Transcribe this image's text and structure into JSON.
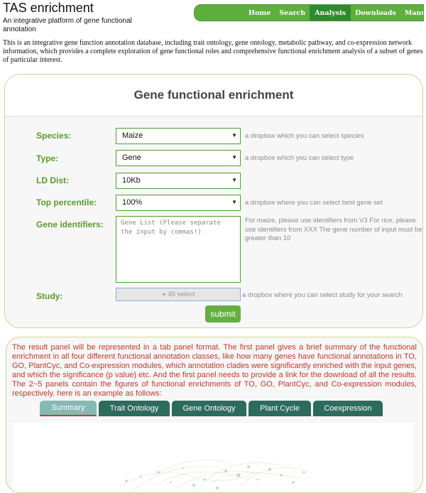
{
  "header": {
    "title": "TAS enrichment",
    "subtitle": "An integrative platform of gene functional annotation",
    "nav": [
      "Home",
      "Search",
      "Analysis",
      "Downloads",
      "Manual"
    ],
    "active_nav": "Analysis",
    "intro": "This is an integrative gene function annotation database, including trait ontology, gene ontology, metabolic pathway, and co-expression network information, which provides a complete exploration of gene functional roles and comprehensive functional enrichment analysis of a subset of genes of particular interest."
  },
  "form": {
    "title": "Gene functional enrichment",
    "species": {
      "label": "Species:",
      "value": "Maize",
      "hint": "a dropbox which you can select species"
    },
    "type": {
      "label": "Type:",
      "value": "Gene",
      "hint": "a dropbox which you can select type"
    },
    "ld_dist": {
      "label": "LD Dist:",
      "value": "10Kb"
    },
    "top_percentile": {
      "label": "Top percentile:",
      "value": "100%",
      "hint": "a dropbox where you can select best gene set"
    },
    "gene_identifiers": {
      "label": "Gene identifiers:",
      "placeholder": "Gene List (Please separate the input by commas!)",
      "hint": "For maize, please use identifiers from V3 For rice, please use identifiers from XXX The gene number of input must be greater than 10"
    },
    "study": {
      "label": "Study:",
      "value": "45 select",
      "hint": "a dropbox where you can select study for your search"
    },
    "submit_label": "submit"
  },
  "result": {
    "text": "The result panel will be represented in a tab panel format. The first panel gives a brief summary of the functional enrichment in all four different functional annotation classes, like how many genes have functional annotations in TO, GO, PlantCyc, and Co-expression modules, which annotation clades were significantly enriched with the input genes, and which the significance (p value) etc. And the first panel needs to provide a link for the download of all the results. The 2~5 panels contain the figures of functional enrichments of TO, GO, PlantCyc, and Co-expression modules, respectively. here is an example as follows:",
    "tabs": [
      "Summary",
      "Trait Ontology",
      "Gene Ontology",
      "Plant Cycle",
      "Coexpression"
    ],
    "active_tab": "Summary"
  },
  "colors": {
    "nav_green": "#5fae3e",
    "nav_active": "#2f8a2f",
    "label_green": "#5a9a2a",
    "tab_teal": "#2d6b5c",
    "tab_active": "#84b9b4",
    "result_text_red": "#c0392b"
  }
}
